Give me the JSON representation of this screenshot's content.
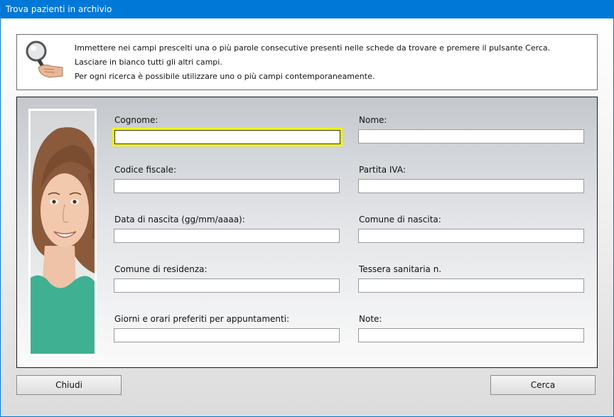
{
  "window": {
    "title": "Trova pazienti in archivio"
  },
  "info": {
    "line1": "Immettere nei campi prescelti una o più parole consecutive presenti nelle schede da trovare e premere il pulsante Cerca.",
    "line2": "Lasciare in bianco tutti gli altri campi.",
    "line3": "Per ogni ricerca è possibile utilizzare uno o più campi contemporaneamente.",
    "icon": "magnifier-hand-icon"
  },
  "photo": {
    "icon": "patient-photo"
  },
  "form": {
    "cognome_label": "Cognome:",
    "nome_label": "Nome:",
    "codice_fiscale_label": "Codice fiscale:",
    "partita_iva_label": "Partita IVA:",
    "data_nascita_label": "Data di nascita (gg/mm/aaaa):",
    "comune_nascita_label": "Comune di nascita:",
    "comune_residenza_label": "Comune di residenza:",
    "tessera_label": "Tessera sanitaria n.",
    "giorni_orari_label": "Giorni e orari preferiti per appuntamenti:",
    "note_label": "Note:",
    "cognome_value": "",
    "nome_value": "",
    "codice_fiscale_value": "",
    "partita_iva_value": "",
    "data_nascita_value": "",
    "comune_nascita_value": "",
    "comune_residenza_value": "",
    "tessera_value": "",
    "giorni_orari_value": "",
    "note_value": ""
  },
  "buttons": {
    "close_label": "Chiudi",
    "search_label": "Cerca"
  },
  "colors": {
    "titlebar": "#0078d7",
    "focus_highlight": "#f5f500"
  }
}
